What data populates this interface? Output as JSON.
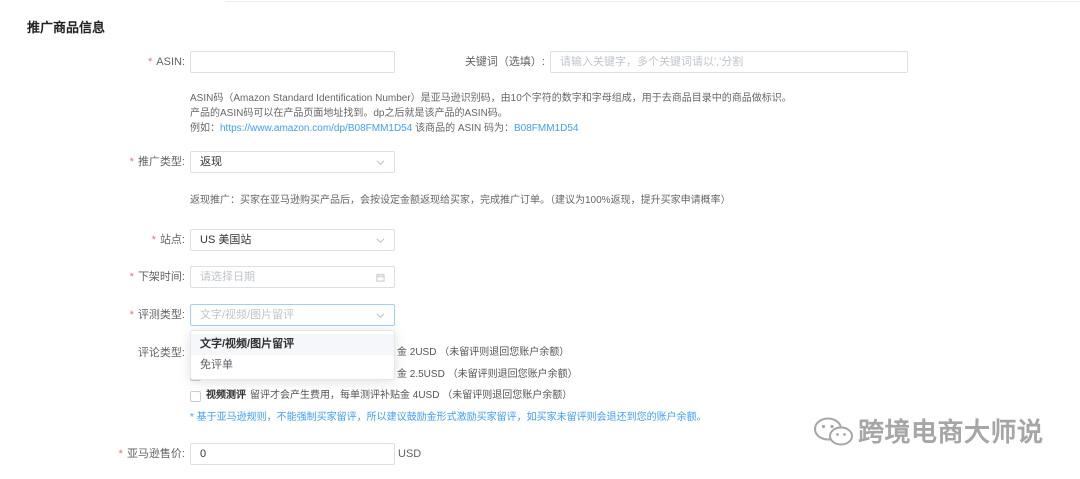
{
  "section_title": "推广商品信息",
  "required_mark": "*",
  "asin": {
    "label": "ASIN:",
    "value": ""
  },
  "keyword": {
    "label": "关键词（选填）:",
    "placeholder": "请输入关键字，多个关键词请以','分割"
  },
  "asin_help": {
    "line1": "ASIN码（Amazon Standard Identification Number）是亚马逊识别码，由10个字符的数字和字母组成，用于去商品目录中的商品做标识。",
    "line2": "产品的ASIN码可以在产品页面地址找到。dp之后就是该产品的ASIN码。",
    "line3_prefix": "例如：",
    "line3_link": "https://www.amazon.com/dp/B08FMM1D54",
    "line3_middle": " 该商品的 ASIN 码为：",
    "line3_code": "B08FMM1D54"
  },
  "promo_type": {
    "label": "推广类型:",
    "value": "返现",
    "help": "返现推广：买家在亚马逊购买产品后，会按设定金额返现给买家，完成推广订单。（建议为100%返现，提升买家申请概率）"
  },
  "site": {
    "label": "站点:",
    "value": "US 美国站"
  },
  "delist_time": {
    "label": "下架时间:",
    "placeholder": "请选择日期"
  },
  "eval_type": {
    "label": "评测类型:",
    "placeholder": "文字/视频/图片留评",
    "options": [
      "文字/视频/图片留评",
      "免评单"
    ]
  },
  "comment_type": {
    "label": "评论类型:",
    "row1_visible": "金 2USD （未留评则退回您账户余额）",
    "row2_visible": "金 2.5USD （未留评则退回您账户余额）",
    "row3_title": "视频测评",
    "row3_desc": "留评才会产生费用，每单测评补贴金 4USD （未留评则退回您账户余额）"
  },
  "note": "* 基于亚马逊规则，不能强制买家留评，所以建议鼓励金形式激励买家留评，如买家未留评则会退还到您的账户余额。",
  "price": {
    "label": "亚马逊售价:",
    "value": "0",
    "unit": "USD"
  },
  "watermark": "跨境电商大师说",
  "colors": {
    "accent": "#409eff",
    "required": "#f56c6c",
    "border": "#dcdfe6",
    "placeholder": "#c0c4cc",
    "label": "#606266"
  }
}
